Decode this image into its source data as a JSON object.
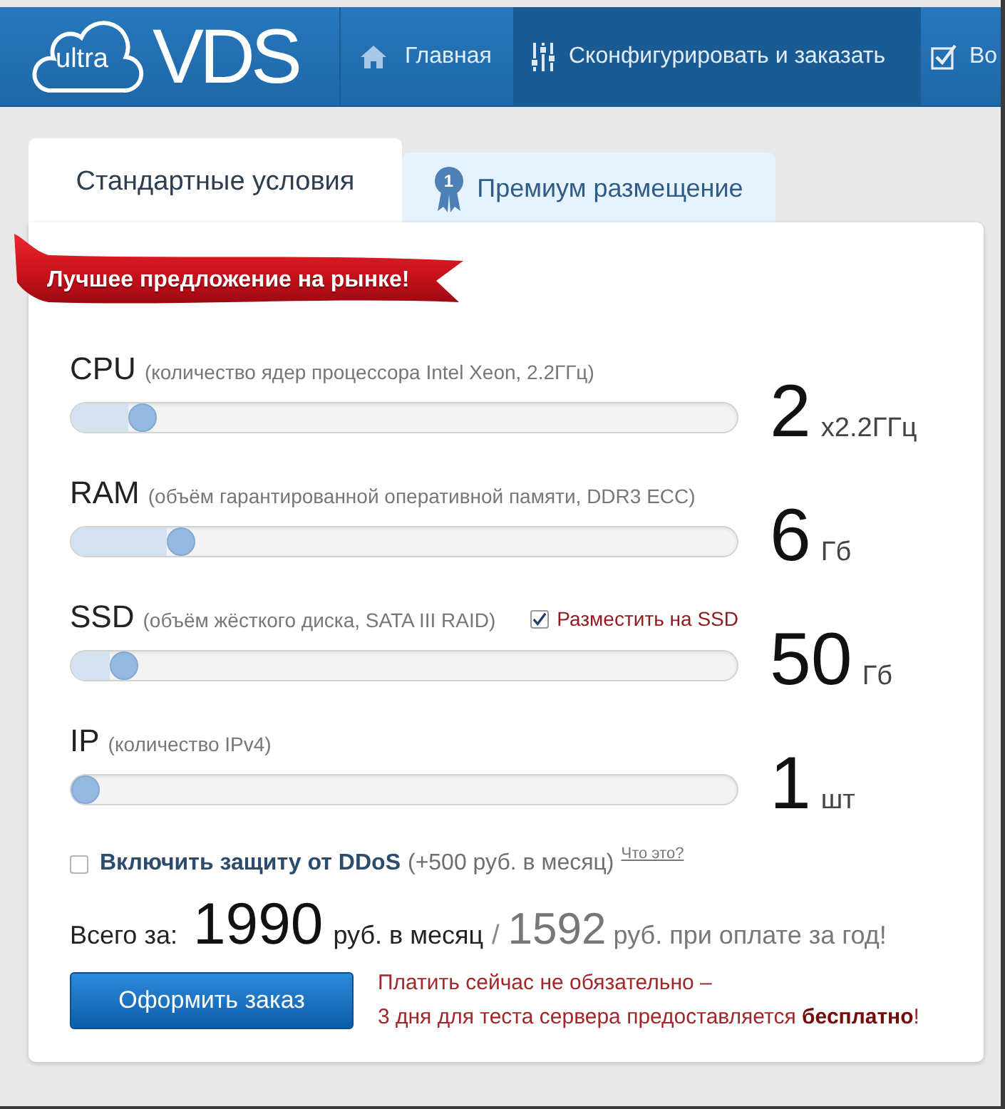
{
  "header": {
    "logo": {
      "badge": "ultra",
      "name": "VDS"
    },
    "nav": [
      {
        "kind": "home",
        "label": "Главная",
        "selected": false
      },
      {
        "kind": "sliders",
        "label": "Сконфигурировать и заказать",
        "selected": true
      },
      {
        "kind": "checkbox",
        "label": "Во",
        "selected": false
      }
    ]
  },
  "tabs": [
    {
      "label": "Стандартные условия",
      "selected": true
    },
    {
      "label": "Премиум размещение",
      "selected": false,
      "badge": "1"
    }
  ],
  "ribbon": "Лучшее предложение на рынке!",
  "sliders": [
    {
      "name": "CPU",
      "description": "(количество ядер процессора Intel Xeon, 2.2ГГц)",
      "level": 0.09,
      "value": "2",
      "unit": "x2.2ГГц"
    },
    {
      "name": "RAM",
      "description": "(объём гарантированной оперативной памяти, DDR3 ECC)",
      "level": 0.15,
      "value": "6",
      "unit": "Гб"
    },
    {
      "name": "SSD",
      "description": "(объём жёсткого диска, SATA III RAID)",
      "option": {
        "label": "Разместить на SSD",
        "checked": true
      },
      "level": 0.06,
      "value": "50",
      "unit": "Гб"
    },
    {
      "name": "IP",
      "description": "(количество IPv4)",
      "level": 0,
      "value": "1",
      "unit": "шт"
    }
  ],
  "ddos": {
    "checked": false,
    "label": "Включить защиту от DDoS",
    "price": "(+500 руб. в месяц)",
    "link": "Что это?"
  },
  "total": {
    "label": "Всего за:",
    "monthly": "1990",
    "monthly_unit": "руб. в месяц",
    "separator": "/",
    "yearly": "1592",
    "yearly_unit": "руб. при оплате за год!"
  },
  "order_button": "Оформить заказ",
  "note": [
    "Платить сейчас не обязательно –",
    "3 дня для теста сервера предоставляется **бесплатно**!"
  ]
}
